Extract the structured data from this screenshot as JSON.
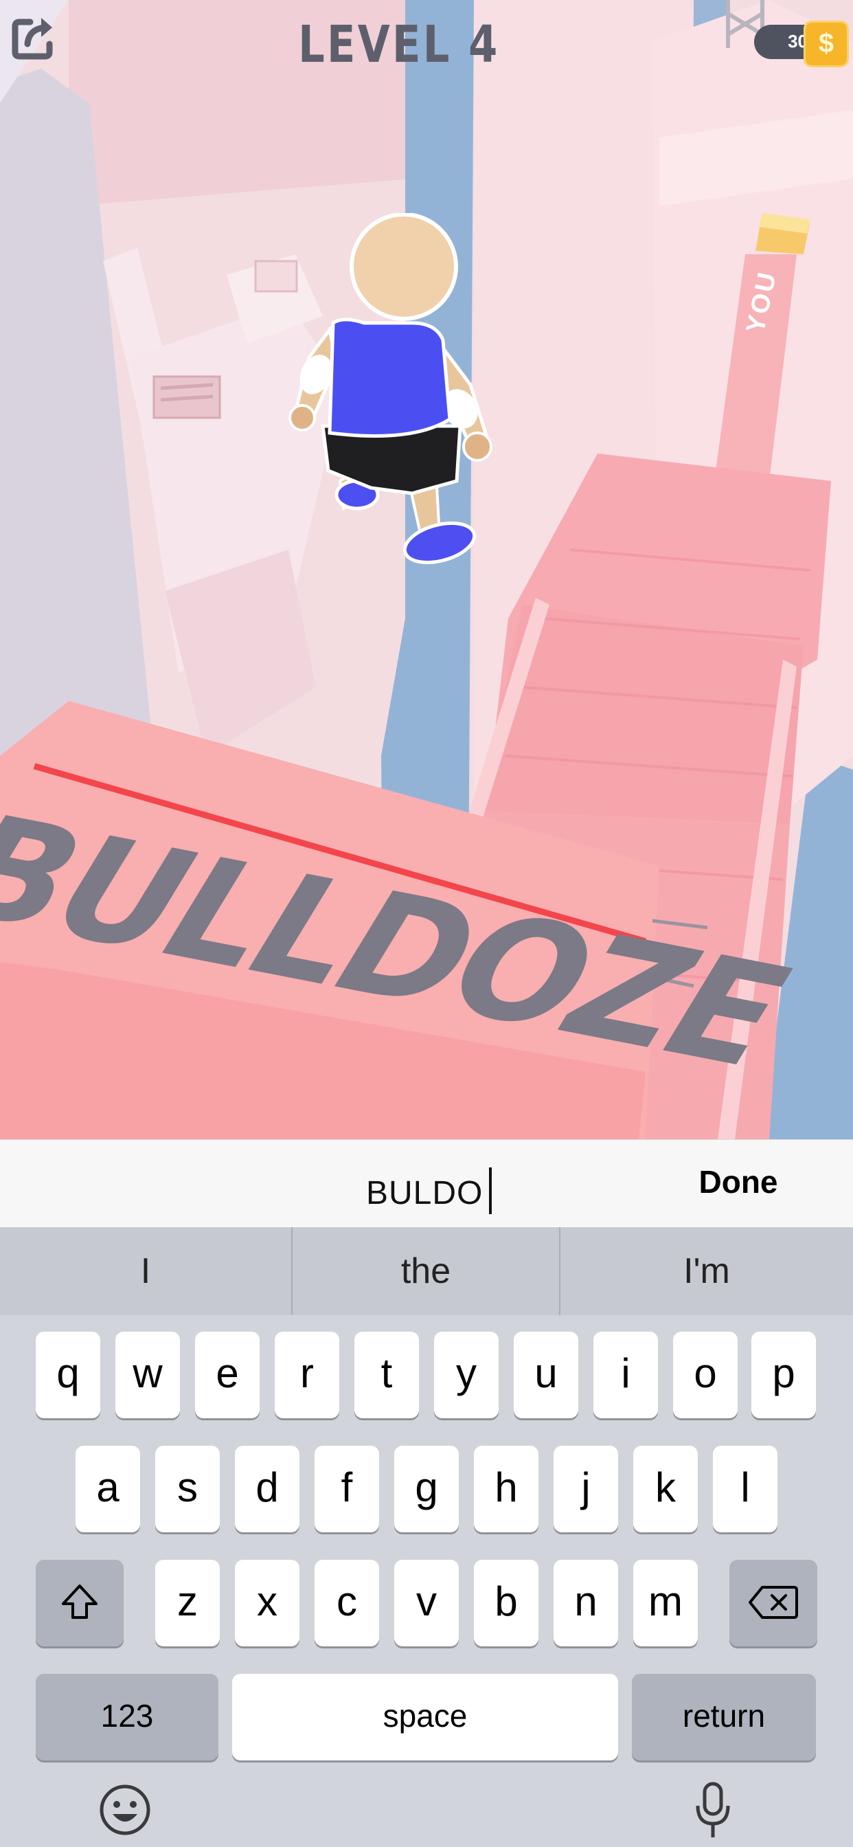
{
  "hud": {
    "level_label": "LEVEL 4",
    "coin_count": "30",
    "coin_icon": "dollar-coin-icon",
    "coin_symbol": "$",
    "share_icon": "share-icon"
  },
  "scene": {
    "wall_word": "BULLDOZE",
    "track_label": "YOU"
  },
  "input": {
    "typed_text": "BULDO",
    "done_label": "Done"
  },
  "suggestions": [
    "I",
    "the",
    "I'm"
  ],
  "keyboard": {
    "row1": [
      "q",
      "w",
      "e",
      "r",
      "t",
      "y",
      "u",
      "i",
      "o",
      "p"
    ],
    "row2": [
      "a",
      "s",
      "d",
      "f",
      "g",
      "h",
      "j",
      "k",
      "l"
    ],
    "row3": [
      "z",
      "x",
      "c",
      "v",
      "b",
      "n",
      "m"
    ],
    "shift_icon": "shift-icon",
    "backspace_icon": "backspace-icon",
    "numbers_label": "123",
    "space_label": "space",
    "return_label": "return",
    "emoji_icon": "emoji-icon",
    "mic_icon": "microphone-icon"
  }
}
